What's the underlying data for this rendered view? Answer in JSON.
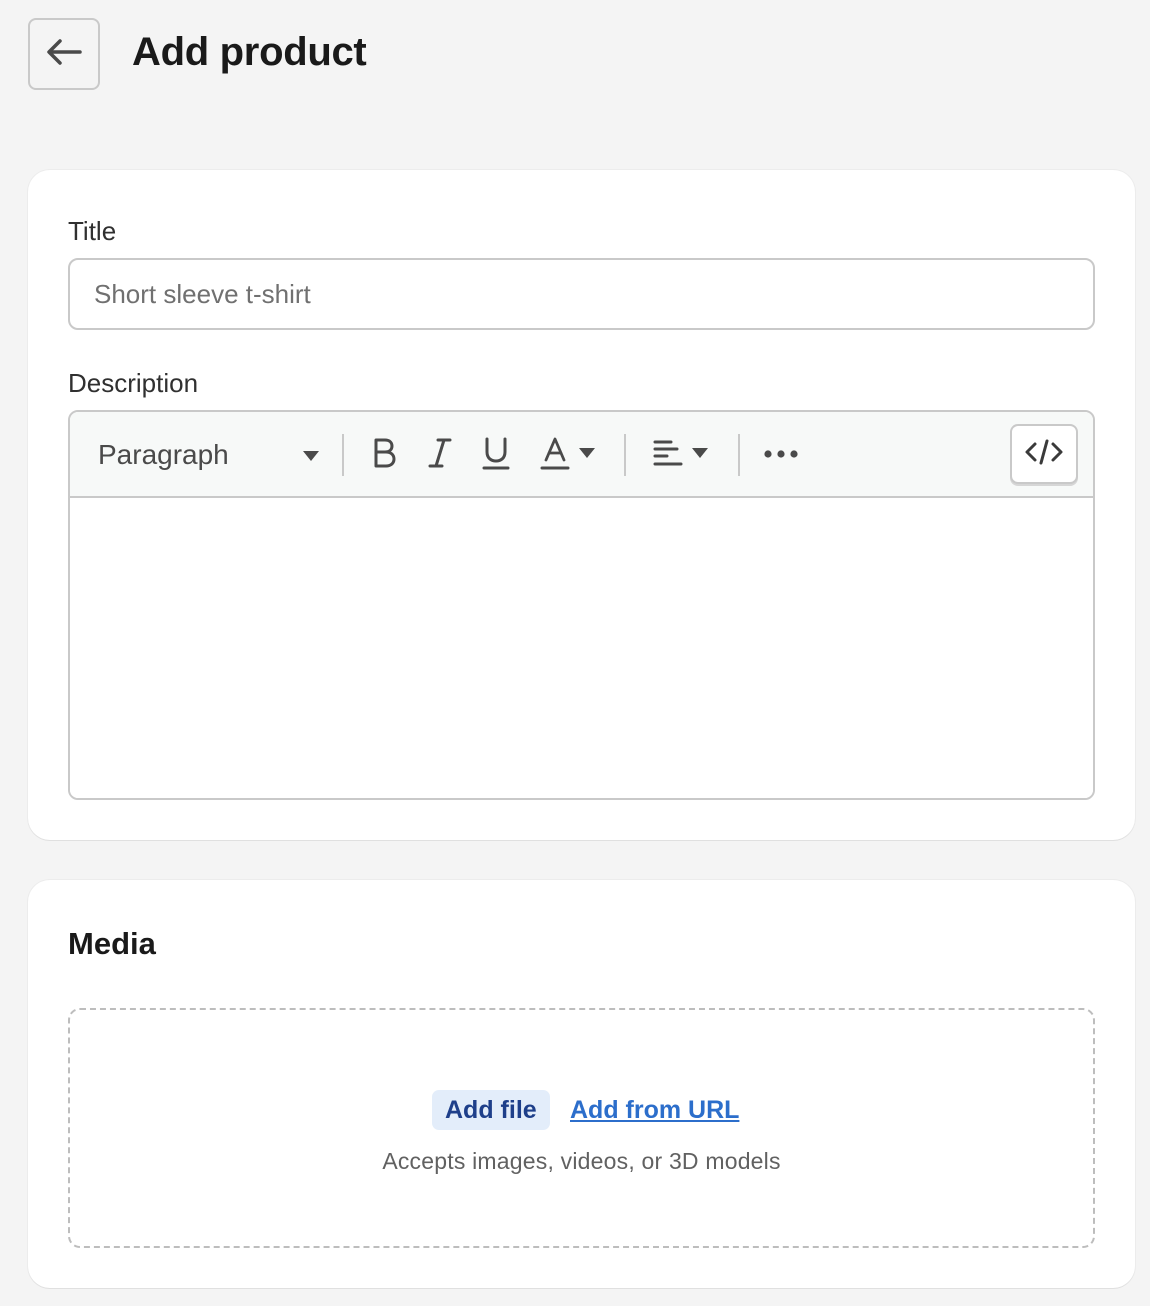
{
  "header": {
    "back_icon": "arrow-left-icon",
    "title": "Add product"
  },
  "product": {
    "title_label": "Title",
    "title_placeholder": "Short sleeve t-shirt",
    "title_value": "",
    "description_label": "Description",
    "toolbar": {
      "format_select": "Paragraph",
      "icons": [
        "chevron-down-icon",
        "bold-icon",
        "italic-icon",
        "underline-icon",
        "text-color-icon",
        "align-left-icon",
        "more-horizontal-icon",
        "code-icon"
      ]
    },
    "description_value": ""
  },
  "media": {
    "heading": "Media",
    "add_file_label": "Add file",
    "add_url_label": "Add from URL",
    "accepts_text": "Accepts images, videos, or 3D models"
  },
  "colors": {
    "background": "#f4f4f4",
    "card": "#ffffff",
    "link": "#2c6ecb",
    "add_file_bg": "#e3edfa",
    "add_file_text": "#1e3f8a"
  }
}
